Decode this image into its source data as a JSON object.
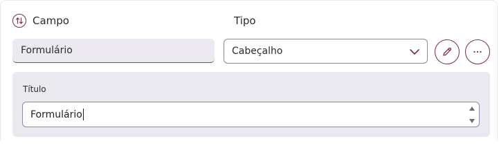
{
  "header": {
    "campo_label": "Campo",
    "tipo_label": "Tipo"
  },
  "field": {
    "value": "Formulário"
  },
  "type_select": {
    "selected": "Cabeçalho"
  },
  "details": {
    "title_label": "Título",
    "title_value": "Formulário"
  },
  "colors": {
    "accent": "#7a2e3e",
    "panel_bg": "#ebe9f0",
    "input_bg": "#eceaf0",
    "focus_border": "#8f86b0"
  },
  "icons": {
    "sort": "sort-arrows-icon",
    "chevron": "chevron-down-icon",
    "edit": "pencil-icon",
    "more": "ellipsis-icon"
  }
}
